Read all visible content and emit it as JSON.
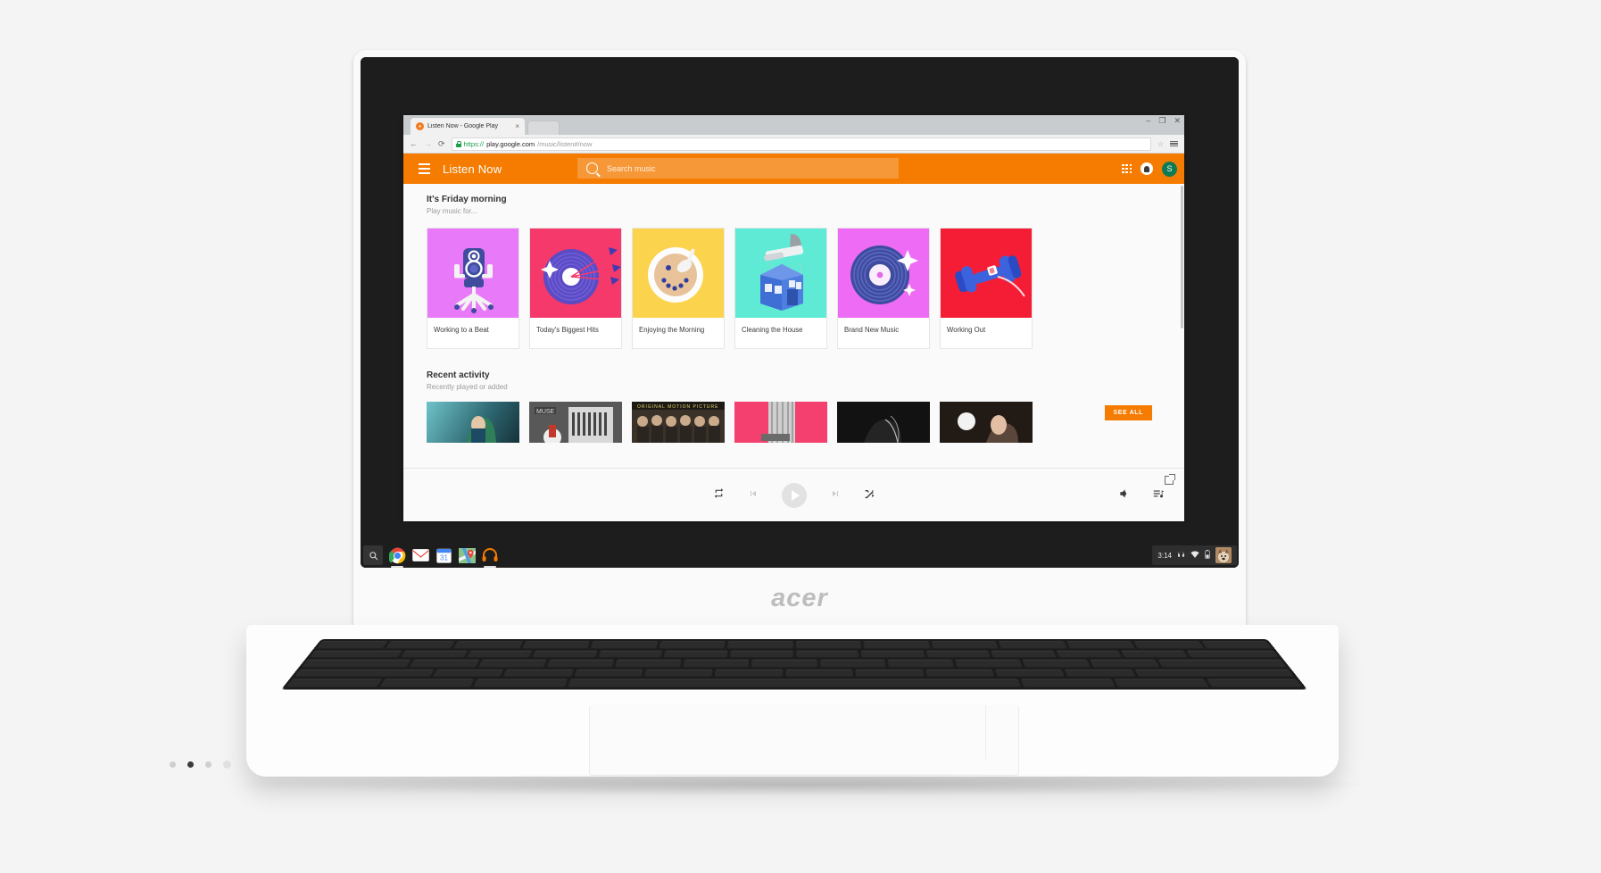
{
  "device": {
    "brand": "acer",
    "type": "Chromebook"
  },
  "browser": {
    "tab": {
      "title": "Listen Now - Google Play",
      "favicon": "headphones-icon",
      "close_label": "×"
    },
    "window_controls": {
      "minimize": "–",
      "maximize": "❐",
      "close": "✕"
    },
    "toolbar": {
      "back": "←",
      "forward": "→",
      "reload": "⟳",
      "bookmark": "☆",
      "menu": "menu-icon"
    },
    "url": {
      "scheme": "https://",
      "host": "play.google.com",
      "path": "/music/listen#/now",
      "secure": true
    }
  },
  "app": {
    "title": "Listen Now",
    "menu_label": "menu-icon",
    "search": {
      "placeholder": "Search music",
      "value": ""
    },
    "actions": {
      "apps": "apps-grid-icon",
      "notifications": "bell-icon",
      "account_initial": "S"
    },
    "accent_color": "#f57c00"
  },
  "sections": [
    {
      "title": "It's Friday morning",
      "subtitle": "Play music for...",
      "see_all": null,
      "cards": [
        {
          "label": "Working to a Beat",
          "bg": "#e879f9",
          "art": "office-chair-speaker"
        },
        {
          "label": "Today's Biggest Hits",
          "bg": "#f6396b",
          "art": "vinyl-dartboard-arrows"
        },
        {
          "label": "Enjoying the Morning",
          "bg": "#fcd34d",
          "art": "cereal-bowl-smiley"
        },
        {
          "label": "Cleaning the House",
          "bg": "#5eead4",
          "art": "vacuum-house"
        },
        {
          "label": "Brand New Music",
          "bg": "#ee6cf5",
          "art": "sparkling-vinyl"
        },
        {
          "label": "Working Out",
          "bg": "#f51d35",
          "art": "dumbbell-earbud"
        }
      ]
    },
    {
      "title": "Recent activity",
      "subtitle": "Recently played or added",
      "see_all": "SEE ALL",
      "thumbs": [
        {
          "alt": "album-art-green-portrait",
          "bg": "#2e6f78"
        },
        {
          "alt": "album-art-muse",
          "bg": "#4a4a4a"
        },
        {
          "alt": "album-art-soundtrack-cast",
          "bg": "#3a3229"
        },
        {
          "alt": "album-art-pink-stripes",
          "bg": "#f4406e"
        },
        {
          "alt": "album-art-dark",
          "bg": "#141414"
        },
        {
          "alt": "album-art-portrait-light",
          "bg": "#201a16"
        }
      ]
    }
  ],
  "player": {
    "repeat": "repeat-icon",
    "previous": "skip-previous-icon",
    "play": "play-icon",
    "next": "skip-next-icon",
    "shuffle": "shuffle-icon",
    "volume": "volume-icon",
    "queue": "queue-icon",
    "popout": "open-in-new-icon",
    "is_playing": false
  },
  "shelf": {
    "launcher": "search-icon",
    "apps": [
      {
        "name": "Chrome",
        "icon": "chrome-icon",
        "active": true
      },
      {
        "name": "Gmail",
        "icon": "gmail-icon",
        "active": false
      },
      {
        "name": "Calendar",
        "icon": "calendar-icon",
        "active": false,
        "day": "31"
      },
      {
        "name": "Maps",
        "icon": "maps-icon",
        "active": false
      },
      {
        "name": "Play Music",
        "icon": "headphones-icon",
        "active": true
      }
    ],
    "tray": {
      "time": "3:14",
      "icons": [
        "headphone-icon",
        "wifi-icon",
        "battery-icon"
      ],
      "avatar": "user-avatar"
    }
  }
}
